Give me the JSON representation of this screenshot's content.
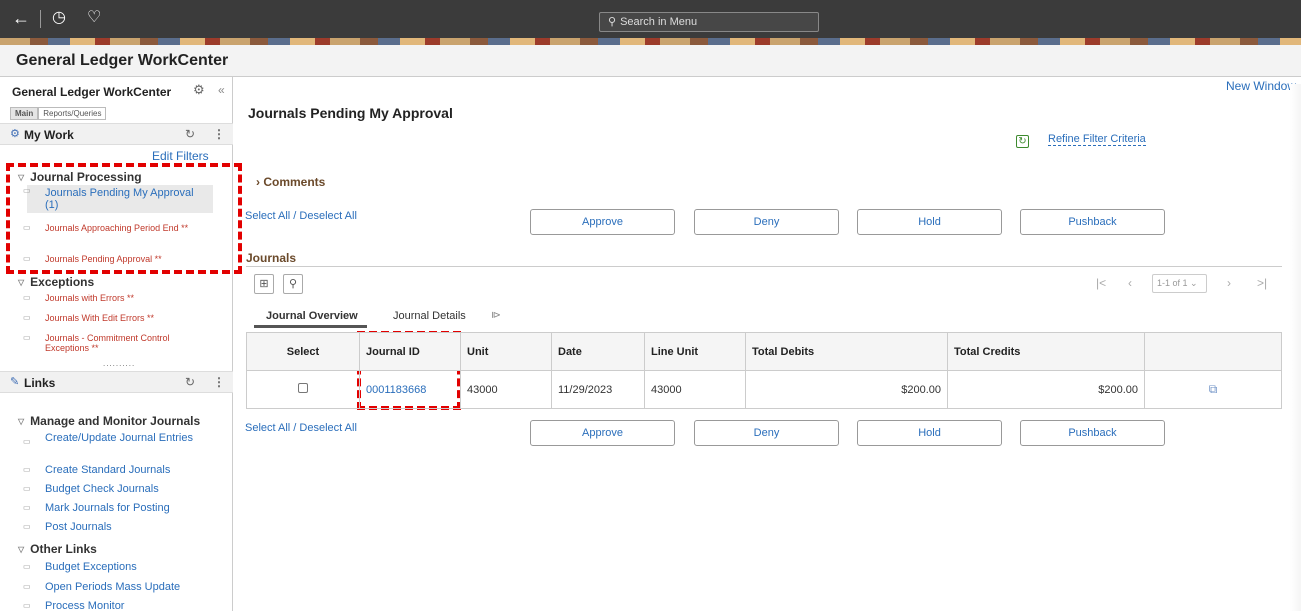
{
  "topbar": {
    "back_icon": "back-arrow-icon",
    "history_icon": "clock-icon",
    "favorites_icon": "heart-icon",
    "search_placeholder": "Search in Menu"
  },
  "title": "General Ledger WorkCenter",
  "left": {
    "title": "General Ledger WorkCenter",
    "tabs": [
      "Main",
      "Reports/Queries"
    ],
    "my_work": "My Work",
    "edit_filters": "Edit Filters",
    "journal_processing": {
      "label": "Journal Processing",
      "items": [
        "Journals Pending My Approval (1)",
        "Journals Approaching Period End **",
        "Journals Pending Approval **"
      ]
    },
    "exceptions": {
      "label": "Exceptions",
      "items": [
        "Journals with Errors **",
        "Journals With Edit Errors **",
        "Journals - Commitment Control Exceptions **"
      ]
    },
    "links": "Links",
    "manage": {
      "label": "Manage and Monitor Journals",
      "items": [
        "Create/Update Journal Entries",
        "Create Standard Journals",
        "Budget Check Journals",
        "Mark Journals for Posting",
        "Post Journals"
      ]
    },
    "other": {
      "label": "Other Links",
      "items": [
        "Budget Exceptions",
        "Open Periods Mass Update",
        "Process Monitor"
      ]
    }
  },
  "main": {
    "new_window": "New Window",
    "page_title": "Journals Pending My Approval",
    "refine": "Refine Filter Criteria",
    "comments": "Comments",
    "select_all": "Select All / Deselect All",
    "buttons": [
      "Approve",
      "Deny",
      "Hold",
      "Pushback"
    ],
    "journals_header": "Journals",
    "pager": "1-1 of 1",
    "grid_tabs": [
      "Journal Overview",
      "Journal Details"
    ],
    "columns": [
      "Select",
      "Journal ID",
      "Unit",
      "Date",
      "Line Unit",
      "Total Debits",
      "Total Credits"
    ],
    "rows": [
      {
        "journal_id": "0001183668",
        "unit": "43000",
        "date": "11/29/2023",
        "line_unit": "43000",
        "total_debits": "$200.00",
        "total_credits": "$200.00"
      }
    ]
  },
  "colors": {
    "link": "#2a6ebb",
    "highlight": "#e20000",
    "topbar": "#3b3b3b",
    "error_link": "#c0392b"
  }
}
